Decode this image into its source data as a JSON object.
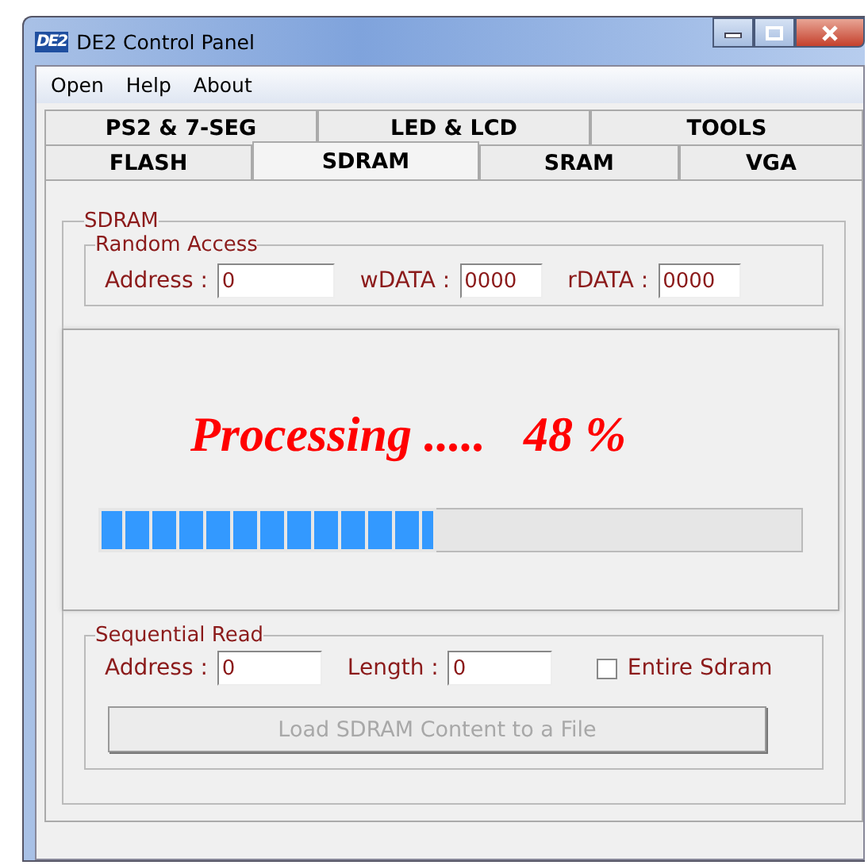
{
  "window": {
    "icon_text": "DE2",
    "title": "DE2 Control Panel"
  },
  "menu": [
    "Open",
    "Help",
    "About"
  ],
  "tab_rows": [
    [
      {
        "label": "PS2 & 7-SEG",
        "selected": false
      },
      {
        "label": "LED & LCD",
        "selected": false
      },
      {
        "label": "TOOLS",
        "selected": false
      }
    ],
    [
      {
        "label": "FLASH",
        "selected": false
      },
      {
        "label": "SDRAM",
        "selected": true
      },
      {
        "label": "SRAM",
        "selected": false
      },
      {
        "label": "VGA",
        "selected": false
      }
    ]
  ],
  "group": {
    "title": "SDRAM",
    "random_access": {
      "title": "Random Access",
      "fields": [
        {
          "label": "Address :",
          "value": "0"
        },
        {
          "label": "wDATA :",
          "value": "0000"
        },
        {
          "label": "rDATA :",
          "value": "0000"
        }
      ]
    },
    "sequential_read": {
      "title": "Sequential Read",
      "fields": [
        {
          "label": "Address :",
          "value": "0"
        },
        {
          "label": "Length :",
          "value": "0"
        }
      ],
      "entire": {
        "label": "Entire Sdram",
        "checked": false
      },
      "button": {
        "label": "Load SDRAM Content to a File",
        "disabled": true
      }
    }
  },
  "progress_dialog": {
    "message": "Processing .....",
    "percent": "48 %",
    "level": 0.48
  }
}
